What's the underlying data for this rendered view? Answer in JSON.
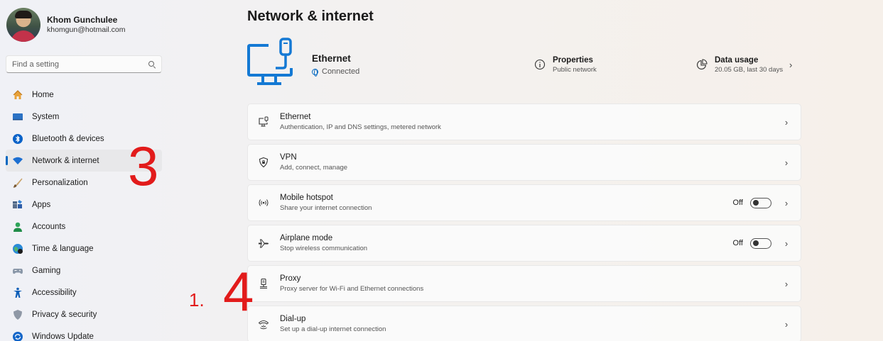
{
  "profile": {
    "name": "Khom Gunchulee",
    "email": "khomgun@hotmail.com"
  },
  "search": {
    "placeholder": "Find a setting",
    "icon": "search-icon"
  },
  "nav": {
    "items": [
      {
        "label": "Home",
        "icon": "home-icon"
      },
      {
        "label": "System",
        "icon": "system-icon"
      },
      {
        "label": "Bluetooth & devices",
        "icon": "bluetooth-icon"
      },
      {
        "label": "Network & internet",
        "icon": "wifi-icon",
        "active": true
      },
      {
        "label": "Personalization",
        "icon": "brush-icon"
      },
      {
        "label": "Apps",
        "icon": "apps-icon"
      },
      {
        "label": "Accounts",
        "icon": "person-icon"
      },
      {
        "label": "Time & language",
        "icon": "globe-clock-icon"
      },
      {
        "label": "Gaming",
        "icon": "gamepad-icon"
      },
      {
        "label": "Accessibility",
        "icon": "accessibility-icon"
      },
      {
        "label": "Privacy & security",
        "icon": "shield-icon"
      },
      {
        "label": "Windows Update",
        "icon": "update-icon"
      }
    ]
  },
  "page": {
    "title": "Network & internet"
  },
  "hero": {
    "name": "Ethernet",
    "status": "Connected",
    "properties": {
      "title": "Properties",
      "sub": "Public network"
    },
    "data_usage": {
      "title": "Data usage",
      "sub": "20.05 GB, last 30 days"
    }
  },
  "cards": [
    {
      "title": "Ethernet",
      "sub": "Authentication, IP and DNS settings, metered network",
      "icon": "ethernet-icon"
    },
    {
      "title": "VPN",
      "sub": "Add, connect, manage",
      "icon": "vpn-shield-icon"
    },
    {
      "title": "Mobile hotspot",
      "sub": "Share your internet connection",
      "icon": "hotspot-icon",
      "toggle": "Off"
    },
    {
      "title": "Airplane mode",
      "sub": "Stop wireless communication",
      "icon": "airplane-icon",
      "toggle": "Off"
    },
    {
      "title": "Proxy",
      "sub": "Proxy server for Wi-Fi and Ethernet connections",
      "icon": "proxy-icon"
    },
    {
      "title": "Dial-up",
      "sub": "Set up a dial-up internet connection",
      "icon": "dialup-icon"
    }
  ],
  "annotations": {
    "step_nav": "3",
    "step_proxy": "4",
    "step_list": "1."
  },
  "colors": {
    "accent": "#0067c0",
    "annotation": "#e21b1b"
  }
}
